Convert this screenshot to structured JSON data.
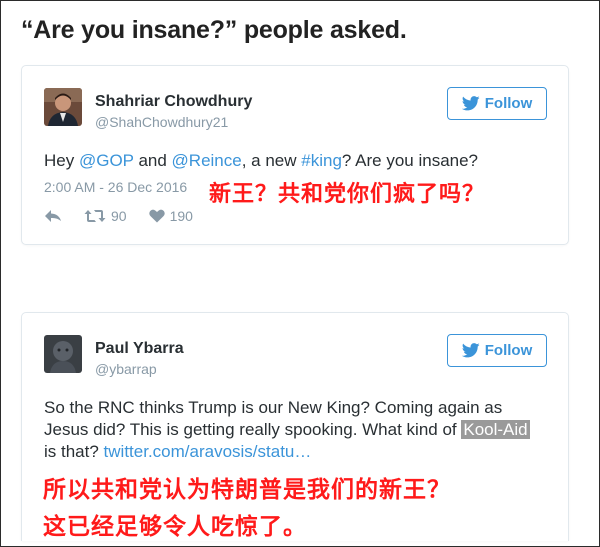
{
  "headline": "“Are you insane?” people asked.",
  "tweets": [
    {
      "name": "Shahriar Chowdhury",
      "handle": "@ShahChowdhury21",
      "follow_label": "Follow",
      "text": {
        "p1": "Hey ",
        "m1": "@GOP",
        "p2": " and ",
        "m2": "@Reince",
        "p3": ", a new ",
        "h1": "#king",
        "p4": "? Are you insane?"
      },
      "timestamp": "2:00 AM - 26 Dec 2016",
      "retweets": "90",
      "likes": "190"
    },
    {
      "name": "Paul Ybarra",
      "handle": "@ybarrap",
      "follow_label": "Follow",
      "text": {
        "p1": "So the RNC thinks Trump is our New King? Coming again as Jesus did? This is getting really spooking. What kind of ",
        "hl": "Kool-Aid",
        "p2": " is that? ",
        "link": "twitter.com/aravosis/statu…"
      }
    }
  ],
  "overlays": {
    "caption1": "新王？共和党你们疯了吗？",
    "caption2_line1": "所以共和党认为特朗普是我们的新王？",
    "caption2_line2": "这已经足够令人吃惊了。"
  },
  "colors": {
    "twitter_blue": "#3b94d9",
    "overlay_red": "#ff1a1a",
    "meta_gray": "#8899a6"
  },
  "icons": {
    "follow": "twitter-bird-icon",
    "reply": "reply-icon",
    "retweet": "retweet-icon",
    "like": "heart-icon"
  }
}
